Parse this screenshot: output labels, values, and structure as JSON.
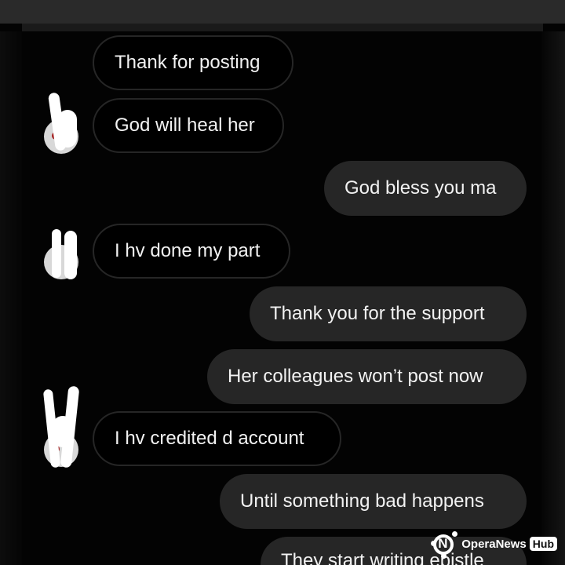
{
  "messages": [
    {
      "text": "Thank for posting",
      "side": "received"
    },
    {
      "text": "God will heal her",
      "side": "received"
    },
    {
      "text": "God bless you ma",
      "side": "sent"
    },
    {
      "text": "I hv done my part",
      "side": "received"
    },
    {
      "text": "Thank you for the support",
      "side": "sent"
    },
    {
      "text": "Her colleagues won’t post now",
      "side": "sent"
    },
    {
      "text": "I hv credited d account",
      "side": "received"
    },
    {
      "text": "Until something bad happens",
      "side": "sent"
    },
    {
      "text": "They start writing epistle",
      "side": "sent"
    }
  ],
  "watermark": {
    "brand": "OperaNews",
    "badge": "Hub"
  },
  "colors": {
    "background": "#000000",
    "sent_bubble": "#262626",
    "received_border": "#262626",
    "text": "#f2f2f2"
  }
}
